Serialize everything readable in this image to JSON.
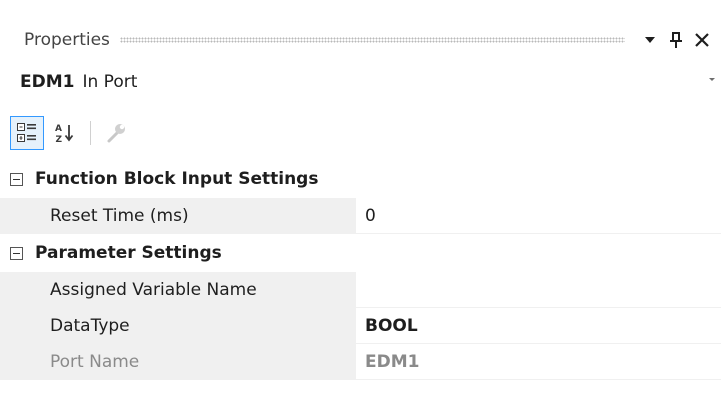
{
  "window": {
    "title": "Properties",
    "buttons": {
      "dropdown_icon": "chevron-down-icon",
      "pin_icon": "pin-icon",
      "close_icon": "close-icon"
    }
  },
  "selector": {
    "name": "EDM1",
    "type": "In Port"
  },
  "toolbar": {
    "items": [
      {
        "icon": "categorized-view-icon",
        "active": true
      },
      {
        "icon": "alphabetical-sort-icon",
        "active": false
      },
      {
        "icon": "property-pages-icon",
        "enabled": false
      }
    ]
  },
  "categories": [
    {
      "label": "Function Block Input Settings",
      "expanded": true,
      "properties": [
        {
          "name": "Reset Time (ms)",
          "value": "0"
        }
      ]
    },
    {
      "label": "Parameter Settings",
      "expanded": true,
      "properties": [
        {
          "name": "Assigned Variable Name",
          "value": ""
        },
        {
          "name": "DataType",
          "value": "BOOL",
          "bold": true
        },
        {
          "name": "Port Name",
          "value": "EDM1",
          "bold": true,
          "disabled": true
        }
      ]
    }
  ],
  "colors": {
    "accent": "#3399ff",
    "name_column_bg": "#f0f0f0",
    "disabled_text": "#8a8a8a"
  }
}
